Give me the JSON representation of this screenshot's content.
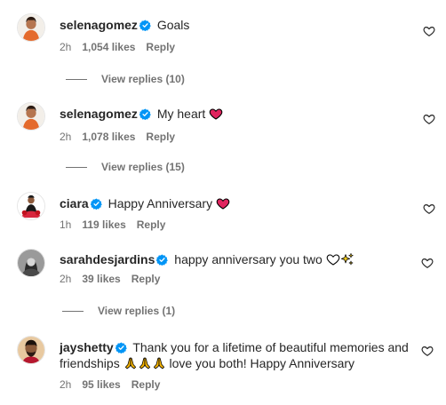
{
  "comments": [
    {
      "username": "selenagomez",
      "text": "Goals",
      "time": "2h",
      "likes": "1,054 likes",
      "reply": "Reply",
      "view_replies": "View replies (10)"
    },
    {
      "username": "selenagomez",
      "text": "My heart",
      "time": "2h",
      "likes": "1,078 likes",
      "reply": "Reply",
      "view_replies": "View replies (15)"
    },
    {
      "username": "ciara",
      "text": "Happy Anniversary",
      "time": "1h",
      "likes": "119 likes",
      "reply": "Reply"
    },
    {
      "username": "sarahdesjardins",
      "text": "happy anniversary you two",
      "time": "2h",
      "likes": "39 likes",
      "reply": "Reply",
      "view_replies": "View replies (1)"
    },
    {
      "username": "jayshetty",
      "text_line1": "Thank you for a lifetime of beautiful memories and",
      "text_line2a": "friendships",
      "text_line2b": "love you both! Happy Anniversary",
      "time": "2h",
      "likes": "95 likes",
      "reply": "Reply"
    }
  ],
  "icons": {
    "verified": "verified-badge-icon",
    "like": "heart-outline-icon",
    "red_heart": "red-heart-emoji",
    "white_heart": "white-heart-emoji",
    "sparkles": "sparkles-emoji",
    "pray": "folded-hands-emoji"
  },
  "colors": {
    "verified_blue": "#0095f6",
    "heart_red": "#e0245e",
    "muted_text": "#737373"
  }
}
